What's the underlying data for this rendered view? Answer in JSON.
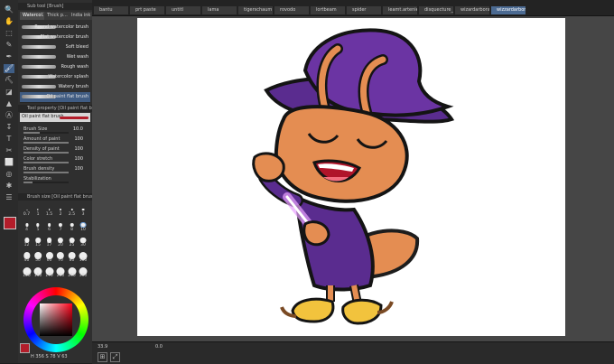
{
  "tools": [
    "🔍",
    "✋",
    "⬚",
    "✎",
    "✒",
    "🖌",
    "⛏",
    "◪",
    "▲",
    "Ⓐ",
    "↧",
    "T",
    "✂",
    "⬜",
    "◎",
    "✱",
    "☰"
  ],
  "subtool": {
    "header": "Sub tool [Brush]",
    "tabs": [
      "Watercol...",
      "Thick p...",
      "India ink"
    ],
    "brushes": [
      "Round watercolor brush",
      "Flat watercolor brush",
      "Soft bleed",
      "Wet wash",
      "Rough wash",
      "Watercolor splash",
      "Watery brush",
      "Oil paint flat brush"
    ]
  },
  "tool_property": {
    "header": "Tool property [Oil paint flat brush]",
    "preset": "Oil paint flat brush",
    "props": [
      {
        "label": "Brush Size",
        "value": "10.0",
        "fill": 0.35
      },
      {
        "label": "Amount of paint",
        "value": "100",
        "fill": 1.0
      },
      {
        "label": "Density of paint",
        "value": "100",
        "fill": 1.0
      },
      {
        "label": "Color stretch",
        "value": "100",
        "fill": 1.0
      },
      {
        "label": "Brush density",
        "value": "100",
        "fill": 1.0
      },
      {
        "label": "Stabilization",
        "value": "",
        "fill": 0.2
      }
    ]
  },
  "brush_size": {
    "header": "Brush size [Oil paint flat brush]",
    "sizes": [
      "0.7",
      "1",
      "1.5",
      "2",
      "2.5",
      "3",
      "4",
      "5",
      "6",
      "7",
      "8",
      "10",
      "12",
      "15",
      "17",
      "20",
      "25",
      "30",
      "40",
      "50",
      "60",
      "70",
      "80",
      "100",
      "120",
      "150",
      "170",
      "200",
      "250",
      "300"
    ],
    "selected": "10"
  },
  "colors": {
    "main": "#b31d2a",
    "sub": "#ffffff",
    "hsv_label": "H 356 S 78 V 63"
  },
  "documents": [
    "bantu",
    "prt paste",
    "untitl",
    "lama",
    "tigerschaum",
    "rovodo",
    "lortbeam",
    "spider",
    "leamt.artenie",
    "disquecture_new",
    "wizardarbora",
    "wizzardarbora2"
  ],
  "active_document": "wizzardarbora2",
  "status": {
    "zoom": "33.9",
    "angle": "0.0"
  }
}
